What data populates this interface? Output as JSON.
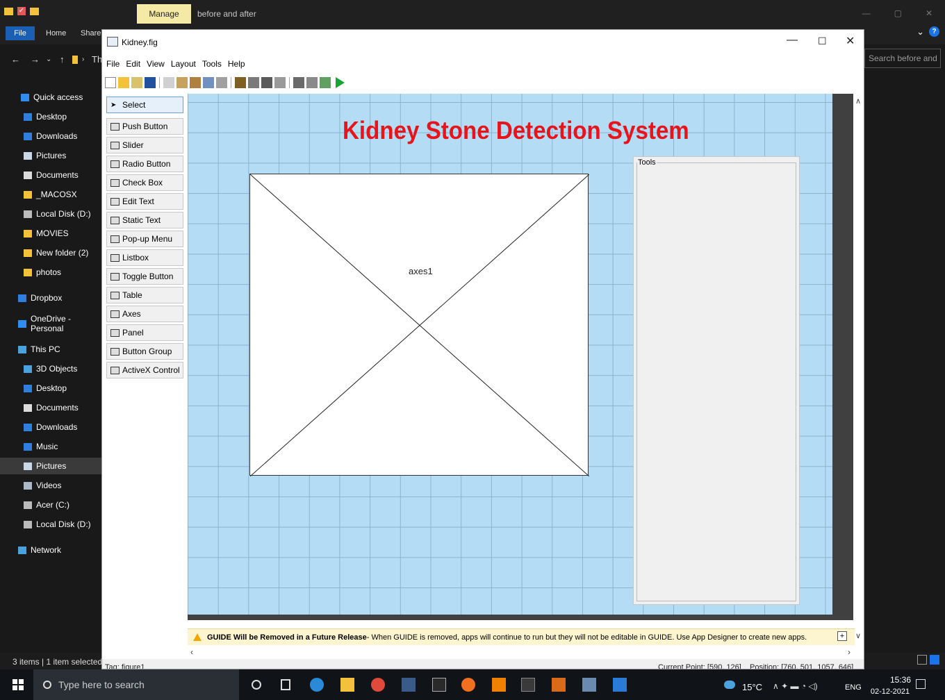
{
  "explorer": {
    "manage_tab": "Manage",
    "window_title": "before and after",
    "ribbon_tabs": [
      "File",
      "Home",
      "Share"
    ],
    "breadcrumb_fragment": "Th",
    "search_placeholder": "Search before and ...",
    "sidebar": [
      {
        "label": "Quick access",
        "icon": "star-icon",
        "color": "#2f8cf0"
      },
      {
        "label": "Desktop",
        "icon": "desktop-icon",
        "color": "#2f7fe0"
      },
      {
        "label": "Downloads",
        "icon": "download-icon",
        "color": "#2f7fe0"
      },
      {
        "label": "Pictures",
        "icon": "pictures-icon",
        "color": "#c8d8e8"
      },
      {
        "label": "Documents",
        "icon": "documents-icon",
        "color": "#dcdcdc"
      },
      {
        "label": "_MACOSX",
        "icon": "folder-icon",
        "color": "#f3c13a"
      },
      {
        "label": "Local Disk (D:)",
        "icon": "drive-icon",
        "color": "#bbbbbb"
      },
      {
        "label": "MOVIES",
        "icon": "folder-icon",
        "color": "#f3c13a"
      },
      {
        "label": "New folder (2)",
        "icon": "folder-icon",
        "color": "#f3c13a"
      },
      {
        "label": "photos",
        "icon": "folder-icon",
        "color": "#f3c13a"
      },
      {
        "label": "Dropbox",
        "icon": "dropbox-icon",
        "color": "#2f7fe0"
      },
      {
        "label": "OneDrive - Personal",
        "icon": "onedrive-icon",
        "color": "#2f8cf0"
      },
      {
        "label": "This PC",
        "icon": "pc-icon",
        "color": "#4aa3df"
      },
      {
        "label": "3D Objects",
        "icon": "3d-objects-icon",
        "color": "#4aa3df"
      },
      {
        "label": "Desktop",
        "icon": "desktop-icon",
        "color": "#2f7fe0"
      },
      {
        "label": "Documents",
        "icon": "documents-icon",
        "color": "#dcdcdc"
      },
      {
        "label": "Downloads",
        "icon": "download-icon",
        "color": "#2f7fe0"
      },
      {
        "label": "Music",
        "icon": "music-icon",
        "color": "#2f7fe0"
      },
      {
        "label": "Pictures",
        "icon": "pictures-icon",
        "color": "#c8d8e8"
      },
      {
        "label": "Videos",
        "icon": "videos-icon",
        "color": "#aab8c8"
      },
      {
        "label": "Acer (C:)",
        "icon": "drive-c-icon",
        "color": "#bbbbbb"
      },
      {
        "label": "Local Disk (D:)",
        "icon": "drive-icon",
        "color": "#bbbbbb"
      },
      {
        "label": "Network",
        "icon": "network-icon",
        "color": "#4aa3df"
      }
    ],
    "status": "3 items  |  1 item selected"
  },
  "guide": {
    "title": "Kidney.fig",
    "menu": [
      "File",
      "Edit",
      "View",
      "Layout",
      "Tools",
      "Help"
    ],
    "palette": [
      {
        "label": "Select",
        "icon": "arrow-cursor-icon"
      },
      {
        "label": "Push Button",
        "icon": "push-button-icon"
      },
      {
        "label": "Slider",
        "icon": "slider-icon"
      },
      {
        "label": "Radio Button",
        "icon": "radio-button-icon"
      },
      {
        "label": "Check Box",
        "icon": "check-box-icon"
      },
      {
        "label": "Edit Text",
        "icon": "edit-text-icon"
      },
      {
        "label": "Static Text",
        "icon": "static-text-icon"
      },
      {
        "label": "Pop-up Menu",
        "icon": "popup-menu-icon"
      },
      {
        "label": "Listbox",
        "icon": "listbox-icon"
      },
      {
        "label": "Toggle Button",
        "icon": "toggle-button-icon"
      },
      {
        "label": "Table",
        "icon": "table-icon"
      },
      {
        "label": "Axes",
        "icon": "axes-icon"
      },
      {
        "label": "Panel",
        "icon": "panel-icon"
      },
      {
        "label": "Button Group",
        "icon": "button-group-icon"
      },
      {
        "label": "ActiveX Control",
        "icon": "activex-icon"
      }
    ],
    "figure_title": "Kidney Stone Detection System",
    "figure_title_color": "#e8141b",
    "axes_label": "axes1",
    "panel_label": "Tools",
    "warning_bold": "GUIDE Will be Removed in a Future Release",
    "warning_text": " - When GUIDE is removed, apps will continue to run but they will not be editable in GUIDE.  Use App Designer to create new apps.",
    "tag": "Tag: figure1",
    "current_point": "Current Point:  [590, 126]",
    "position": "Position: [760, 501, 1057, 646]"
  },
  "taskbar": {
    "search_placeholder": "Type here to search",
    "temperature": "15°C",
    "language": "ENG",
    "time": "15:36",
    "date": "02-12-2021"
  }
}
